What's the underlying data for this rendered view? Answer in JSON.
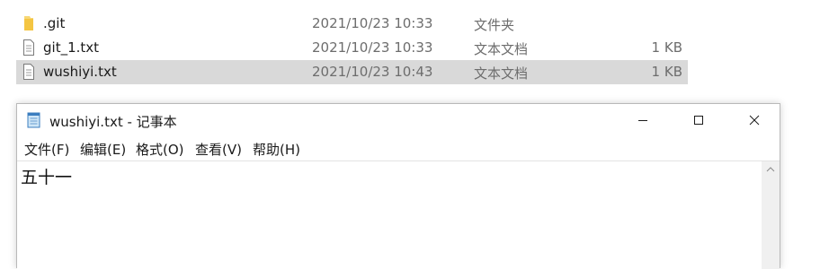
{
  "files": [
    {
      "name": ".git",
      "date": "2021/10/23 10:33",
      "type": "文件夹",
      "size": "",
      "icon": "folder-icon",
      "selected": false
    },
    {
      "name": "git_1.txt",
      "date": "2021/10/23 10:33",
      "type": "文本文档",
      "size": "1 KB",
      "icon": "text-file-icon",
      "selected": false
    },
    {
      "name": "wushiyi.txt",
      "date": "2021/10/23 10:43",
      "type": "文本文档",
      "size": "1 KB",
      "icon": "text-file-icon",
      "selected": true
    }
  ],
  "notepad": {
    "title": "wushiyi.txt - 记事本",
    "app_icon": "notepad-icon",
    "window_buttons": {
      "minimize": "minimize-icon",
      "maximize": "maximize-icon",
      "close": "close-icon"
    },
    "menu": [
      {
        "label": "文件(F)"
      },
      {
        "label": "编辑(E)"
      },
      {
        "label": "格式(O)"
      },
      {
        "label": "查看(V)"
      },
      {
        "label": "帮助(H)"
      }
    ],
    "content": "五十一"
  },
  "colors": {
    "selection": "#d9d9d9",
    "muted_text": "#6d6d6d",
    "folder": "#f4c542",
    "scrollbar": "#f0f0f0"
  }
}
